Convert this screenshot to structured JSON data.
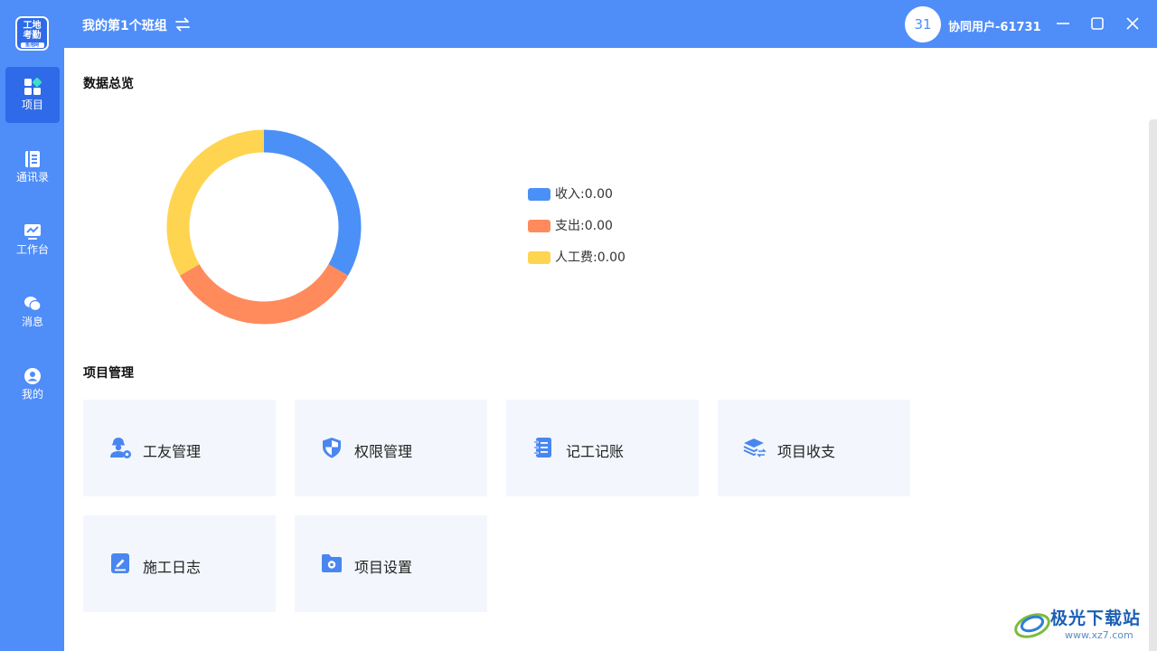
{
  "app": {
    "logo_line1": "工地",
    "logo_line2": "考勤",
    "logo_sub": "鱼泡网"
  },
  "sidebar": {
    "items": [
      {
        "label": "项目",
        "icon": "grid-icon",
        "active": true
      },
      {
        "label": "通讯录",
        "icon": "contacts-book-icon",
        "active": false
      },
      {
        "label": "工作台",
        "icon": "dashboard-monitor-icon",
        "active": false
      },
      {
        "label": "消息",
        "icon": "chat-bubbles-icon",
        "active": false
      },
      {
        "label": "我的",
        "icon": "user-icon",
        "active": false
      }
    ]
  },
  "topbar": {
    "team_name": "我的第1个班组",
    "avatar_text": "31",
    "user_name": "协同用户-61731"
  },
  "overview": {
    "title": "数据总览"
  },
  "chart_data": {
    "type": "pie",
    "categories": [
      "收入",
      "支出",
      "人工费"
    ],
    "values": [
      0.0,
      0.0,
      0.0
    ],
    "legend_labels": [
      "收入:0.00",
      "支出:0.00",
      "人工费:0.00"
    ],
    "colors": [
      "#4a90f7",
      "#ff8a5c",
      "#ffd451"
    ],
    "donut": true,
    "legend": "right"
  },
  "management": {
    "title": "项目管理",
    "cards": [
      {
        "label": "工友管理",
        "icon": "worker-gear-icon"
      },
      {
        "label": "权限管理",
        "icon": "shield-icon"
      },
      {
        "label": "记工记账",
        "icon": "ledger-icon"
      },
      {
        "label": "项目收支",
        "icon": "layers-exchange-icon"
      },
      {
        "label": "施工日志",
        "icon": "edit-note-icon"
      },
      {
        "label": "项目设置",
        "icon": "folder-settings-icon"
      }
    ]
  },
  "watermark": {
    "text": "极光下载站",
    "url": "www.xz7.com"
  },
  "colors": {
    "primary": "#4f8df9",
    "active_nav": "#2f6be8",
    "card_bg": "#f3f7fd",
    "icon_blue": "#4a86f0"
  }
}
